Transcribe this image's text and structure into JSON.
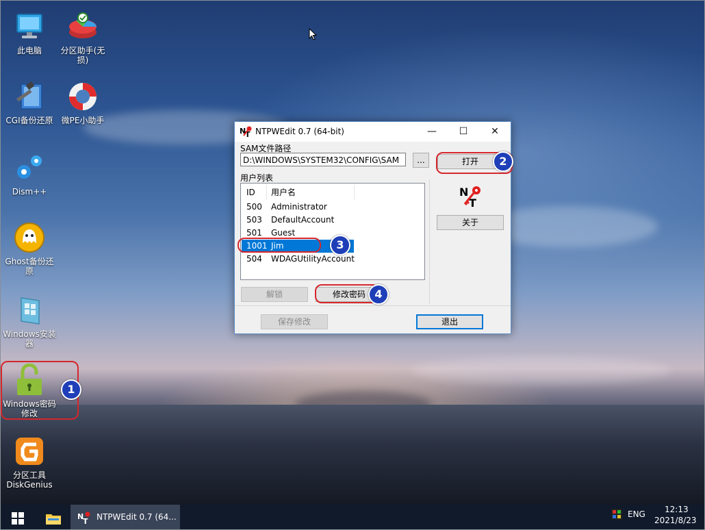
{
  "desktop": {
    "icons": [
      {
        "label": "此电脑",
        "icon": "computer-icon"
      },
      {
        "label": "分区助手(无损)",
        "icon": "partition-assistant-icon"
      },
      {
        "label": "CGI备份还原",
        "icon": "cgi-backup-icon"
      },
      {
        "label": "微PE小助手",
        "icon": "lifebuoy-icon"
      },
      {
        "label": "Dism++",
        "icon": "gears-icon"
      },
      {
        "label": "Ghost备份还原",
        "icon": "ghost-icon"
      },
      {
        "label": "Windows安装器",
        "icon": "windows-installer-icon"
      },
      {
        "label": "Windows密码修改",
        "icon": "unlock-icon"
      },
      {
        "label": "分区工具DiskGenius",
        "icon": "diskgenius-icon"
      }
    ],
    "badges": [
      "1",
      "2",
      "3",
      "4"
    ]
  },
  "window": {
    "title": "NTPWEdit 0.7 (64-bit)",
    "sam_label": "SAM文件路径",
    "sam_path": "D:\\WINDOWS\\SYSTEM32\\CONFIG\\SAM",
    "browse_label": "...",
    "open_label": "打开",
    "user_list_label": "用户列表",
    "columns": {
      "id": "ID",
      "name": "用户名"
    },
    "users": [
      {
        "id": "500",
        "name": "Administrator"
      },
      {
        "id": "503",
        "name": "DefaultAccount"
      },
      {
        "id": "501",
        "name": "Guest"
      },
      {
        "id": "1001",
        "name": "Jim"
      },
      {
        "id": "504",
        "name": "WDAGUtilityAccount"
      }
    ],
    "selected_user": "1001",
    "logo_text": "NT",
    "about_label": "关于",
    "unlock_label": "解锁",
    "change_password_label": "修改密码",
    "save_label": "保存修改",
    "exit_label": "退出",
    "controls": {
      "minimize": "—",
      "maximize": "☐",
      "close": "✕"
    }
  },
  "taskbar": {
    "app_label": "NTPWEdit 0.7 (64...",
    "language": "ENG",
    "time": "12:13",
    "date": "2021/8/23"
  },
  "colors": {
    "accent": "#0078d7",
    "annotation": "#d6262b",
    "badge": "#1f3fb8",
    "taskbar": "#101a2b"
  }
}
